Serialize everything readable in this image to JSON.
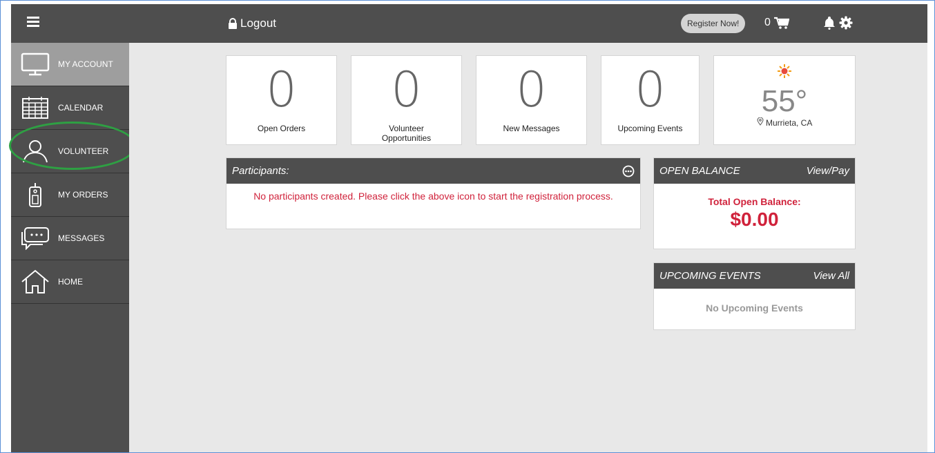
{
  "header": {
    "logout_label": "Logout",
    "register_label": "Register Now!",
    "cart_count": "0"
  },
  "sidebar": {
    "items": [
      {
        "label": "MY ACCOUNT",
        "icon": "monitor-icon"
      },
      {
        "label": "CALENDAR",
        "icon": "calendar-icon"
      },
      {
        "label": "VOLUNTEER",
        "icon": "person-icon"
      },
      {
        "label": "MY ORDERS",
        "icon": "tag-icon"
      },
      {
        "label": "MESSAGES",
        "icon": "chat-icon"
      },
      {
        "label": "HOME",
        "icon": "home-icon"
      }
    ]
  },
  "stats": [
    {
      "value": "0",
      "label": "Open Orders"
    },
    {
      "value": "0",
      "label": "Volunteer Opportunities"
    },
    {
      "value": "0",
      "label": "New Messages"
    },
    {
      "value": "0",
      "label": "Upcoming Events"
    }
  ],
  "weather": {
    "temperature": "55°",
    "location": "Murrieta, CA"
  },
  "participants": {
    "title": "Participants:",
    "message": "No participants created. Please click the above icon to start the registration process."
  },
  "open_balance": {
    "title": "OPEN BALANCE",
    "link": "View/Pay",
    "label": "Total Open Balance:",
    "amount": "$0.00"
  },
  "upcoming_events": {
    "title": "UPCOMING EVENTS",
    "link": "View All",
    "empty_message": "No Upcoming Events"
  },
  "colors": {
    "dark": "#4e4e4e",
    "accent_red": "#d0223b",
    "highlight_green": "#2ea043"
  }
}
